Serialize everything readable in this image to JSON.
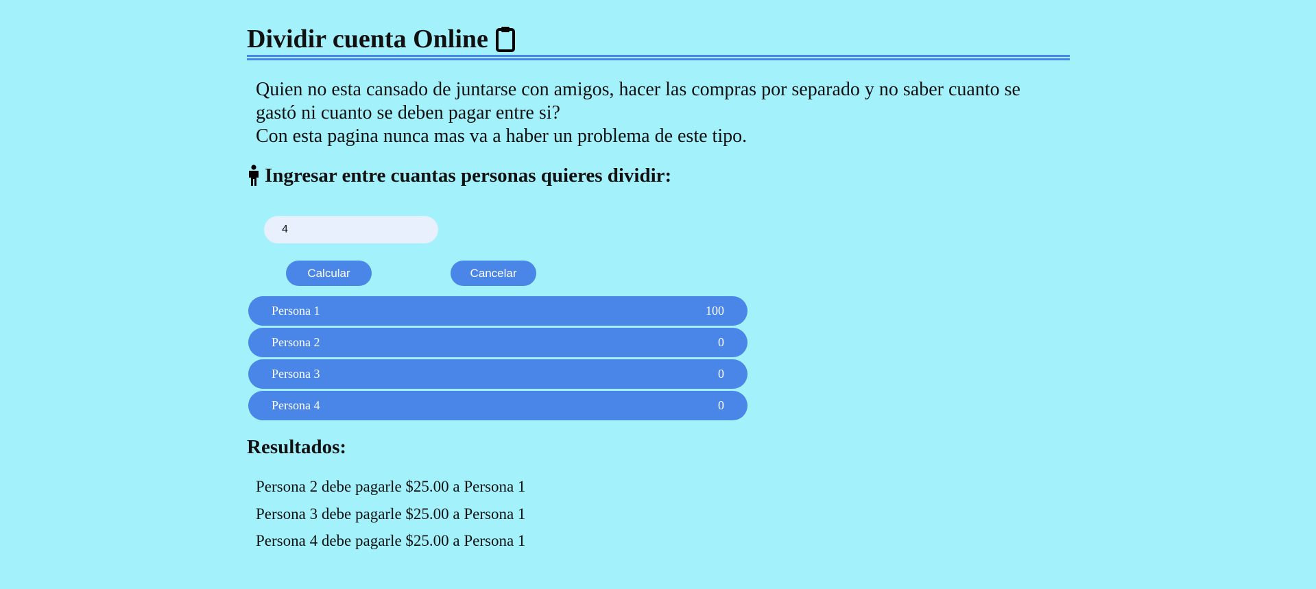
{
  "header": {
    "title": "Dividir cuenta Online",
    "title_icon": "clipboard-icon"
  },
  "intro": {
    "line1": "Quien no esta cansado de juntarse con amigos, hacer las compras por separado y no saber cuanto se gastó ni cuanto se deben pagar entre si?",
    "line2": "Con esta pagina nunca mas va a haber un problema de este tipo."
  },
  "people_section": {
    "heading": "Ingresar entre cuantas personas quieres dividir:",
    "icon": "person-icon",
    "count_value": "4"
  },
  "buttons": {
    "calculate": "Calcular",
    "cancel": "Cancelar"
  },
  "people": [
    {
      "name": "Persona 1",
      "amount": "100"
    },
    {
      "name": "Persona 2",
      "amount": "0"
    },
    {
      "name": "Persona 3",
      "amount": "0"
    },
    {
      "name": "Persona 4",
      "amount": "0"
    }
  ],
  "results": {
    "heading": "Resultados:",
    "lines": [
      "Persona 2 debe pagarle $25.00 a Persona 1",
      "Persona 3 debe pagarle $25.00 a Persona 1",
      "Persona 4 debe pagarle $25.00 a Persona 1"
    ]
  },
  "colors": {
    "background": "#a3f1fb",
    "accent": "#4a86e8",
    "input_bg": "#e8f0fe"
  }
}
